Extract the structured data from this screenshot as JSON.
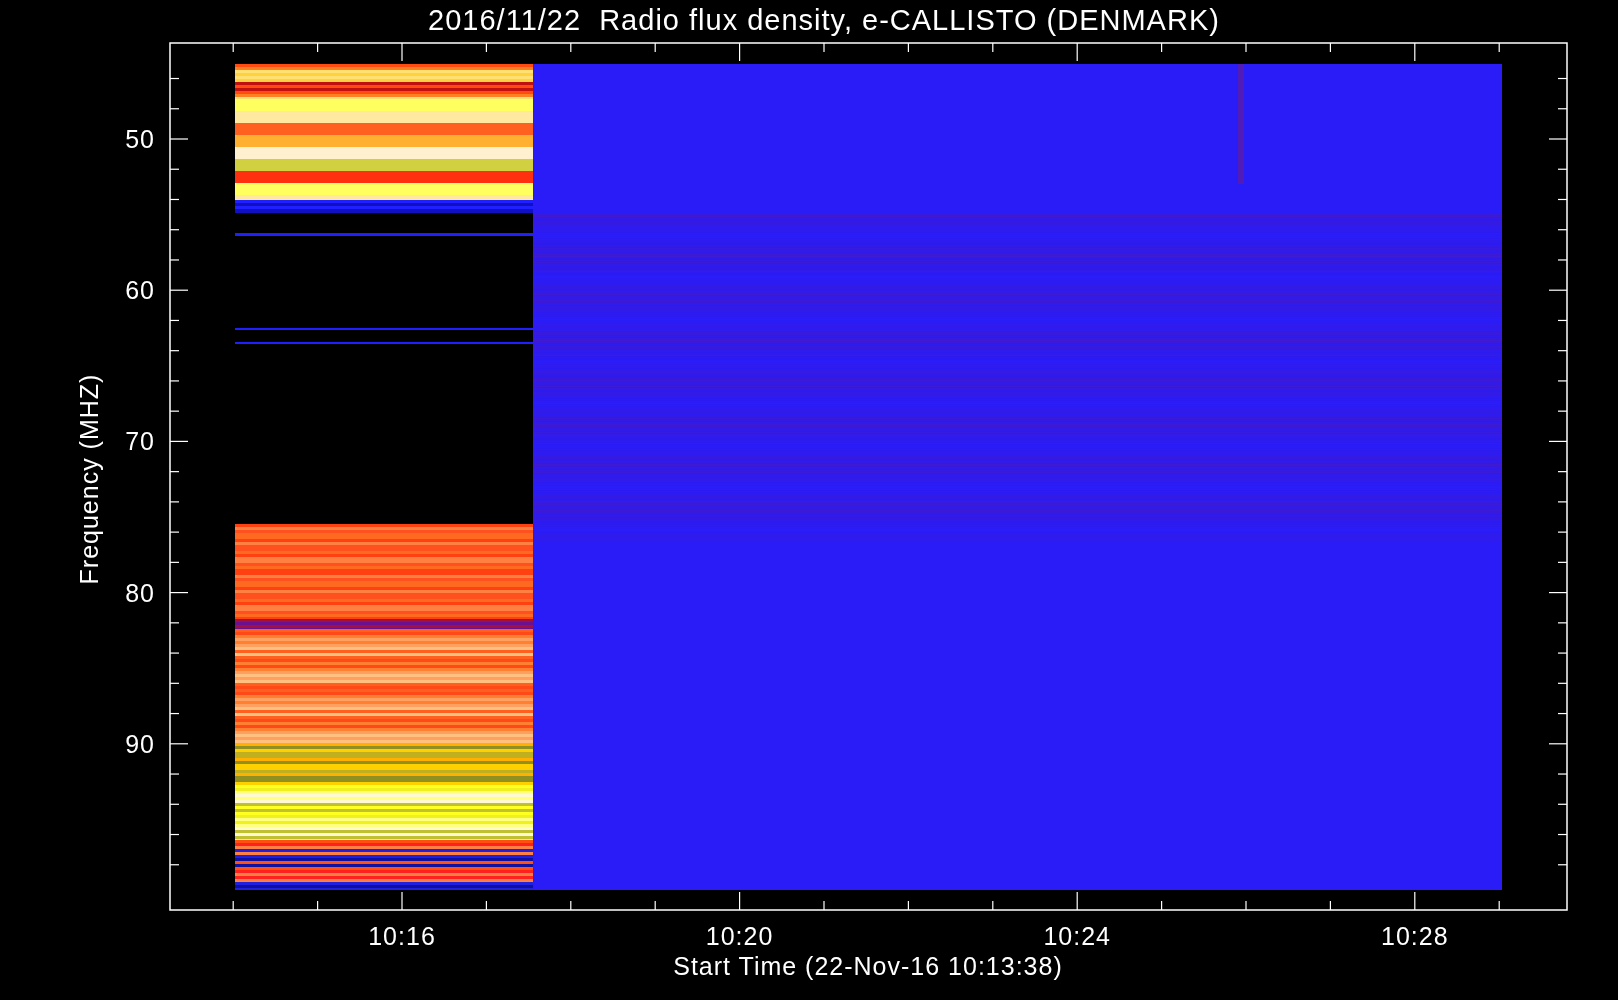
{
  "title": "2016/11/22  Radio flux density, e-CALLISTO (DENMARK)",
  "plot": {
    "xlabel": "Start Time (22-Nov-16 10:13:38)",
    "ylabel": "Frequency (MHZ)",
    "xtick_labels": [
      "10:16",
      "10:20",
      "10:24",
      "10:28"
    ],
    "ytick_labels": [
      "50",
      "60",
      "70",
      "80",
      "90"
    ]
  }
}
